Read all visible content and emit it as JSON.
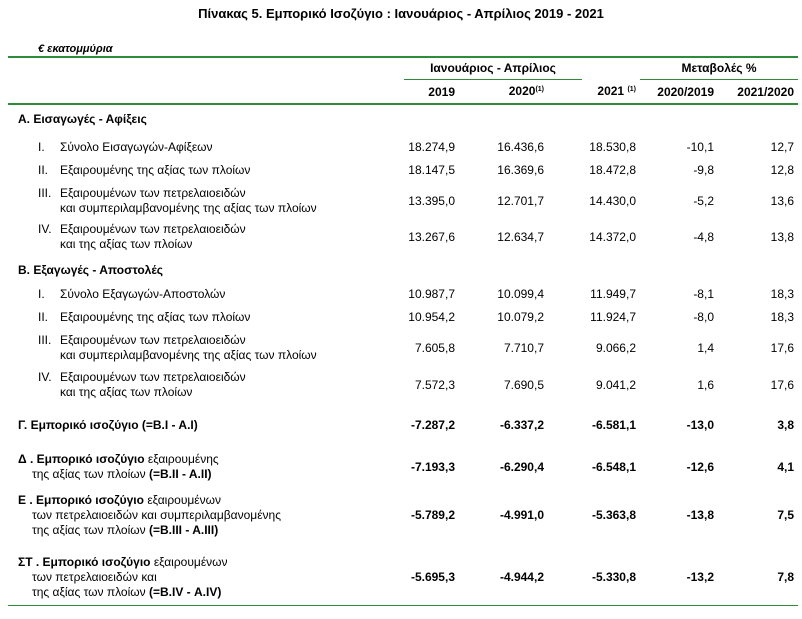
{
  "title": "Πίνακας 5. Εμπορικό Ισοζύγιο : Ιανουάριος - Απρίλιος 2019 - 2021",
  "unit": "€ εκατομμύρια",
  "header": {
    "group_period": "Ιανουάριος - Απρίλιος",
    "group_change": "Μεταβολές %",
    "y2019": "2019",
    "y2020": "2020",
    "y2020_note": "(1)",
    "y2021": "2021",
    "y2021_note": "(1)",
    "c1": "2020/2019",
    "c2": "2021/2020"
  },
  "sections": {
    "A": "Α. Εισαγωγές - Αφίξεις",
    "B": "Β. Εξαγωγές - Αποστολές"
  },
  "rows": {
    "a1": {
      "n": "I.",
      "l1": "Σύνολο Εισαγωγών-Αφίξεων",
      "v": [
        "18.274,9",
        "16.436,6",
        "18.530,8",
        "-10,1",
        "12,7"
      ]
    },
    "a2": {
      "n": "II.",
      "l1": "Εξαιρουμένης  της αξίας των πλοίων",
      "v": [
        "18.147,5",
        "16.369,6",
        "18.472,8",
        "-9,8",
        "12,8"
      ]
    },
    "a3": {
      "n": "III.",
      "l1": "Εξαιρουμένων των πετρελαιοειδών",
      "l2": "και συμπεριλαμβανομένης της αξίας των πλοίων",
      "v": [
        "13.395,0",
        "12.701,7",
        "14.430,0",
        "-5,2",
        "13,6"
      ]
    },
    "a4": {
      "n": "IV.",
      "l1": "Εξαιρουμένων των πετρελαιοειδών",
      "l2": "και  της αξίας των πλοίων",
      "v": [
        "13.267,6",
        "12.634,7",
        "14.372,0",
        "-4,8",
        "13,8"
      ]
    },
    "b1": {
      "n": "I.",
      "l1": "Σύνολο Εξαγωγών-Αποστολών",
      "v": [
        "10.987,7",
        "10.099,4",
        "11.949,7",
        "-8,1",
        "18,3"
      ]
    },
    "b2": {
      "n": "II.",
      "l1": "Εξαιρουμένης  της αξίας των πλοίων",
      "v": [
        "10.954,2",
        "10.079,2",
        "11.924,7",
        "-8,0",
        "18,3"
      ]
    },
    "b3": {
      "n": "III.",
      "l1": "Εξαιρουμένων των πετρελαιοειδών",
      "l2": "και συμπεριλαμβανομένης  της αξίας των πλοίων",
      "v": [
        "7.605,8",
        "7.710,7",
        "9.066,2",
        "1,4",
        "17,6"
      ]
    },
    "b4": {
      "n": "IV.",
      "l1": "Εξαιρουμένων των πετρελαιοειδών",
      "l2": "και  της αξίας των πλοίων",
      "v": [
        "7.572,3",
        "7.690,5",
        "9.041,2",
        "1,6",
        "17,6"
      ]
    },
    "g": {
      "l1b": "Γ. Εμπορικό ισοζύγιο (=Β.Ι - Α.Ι)",
      "v": [
        "-7.287,2",
        "-6.337,2",
        "-6.581,1",
        "-13,0",
        "3,8"
      ]
    },
    "d": {
      "l1b": "Δ . Εμπορικό ισοζύγιο",
      "l1": " εξαιρουμένης",
      "l2": "της αξίας των πλοίων",
      "l2b": " (=Β.ΙΙ - Α.ΙΙ)",
      "v": [
        "-7.193,3",
        "-6.290,4",
        "-6.548,1",
        "-12,6",
        "4,1"
      ]
    },
    "e": {
      "l1b": "Ε . Εμπορικό ισοζύγιο",
      "l1": " εξαιρουμένων",
      "l2": "των πετρελαιοειδών και συμπεριλαμβανομένης",
      "l3": "της αξίας των πλοίων",
      "l3b": " (=Β.ΙΙΙ - Α.ΙΙΙ)",
      "v": [
        "-5.789,2",
        "-4.991,0",
        "-5.363,8",
        "-13,8",
        "7,5"
      ]
    },
    "st": {
      "l1b": "ΣΤ . Εμπορικό ισοζύγιο",
      "l1": " εξαιρουμένων",
      "l2": "των πετρελαιοειδών και",
      "l3": "της αξίας των πλοίων",
      "l3b": " (=Β.IV - Α.IV)",
      "v": [
        "-5.695,3",
        "-4.944,2",
        "-5.330,8",
        "-13,2",
        "7,8"
      ]
    }
  }
}
